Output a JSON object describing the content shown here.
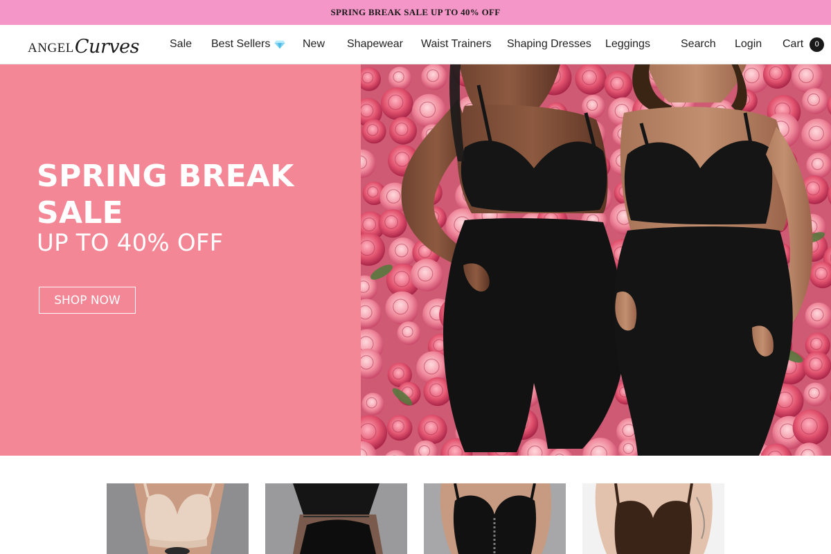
{
  "announcement": {
    "text": "SPRING BREAK SALE UP TO 40% OFF"
  },
  "header": {
    "logo": {
      "word1": "ANGEL",
      "word2": "Curves"
    },
    "nav": [
      {
        "label": "Sale"
      },
      {
        "label": "Best Sellers",
        "icon": "gem-icon"
      },
      {
        "label": "New"
      },
      {
        "label": "Shapewear"
      },
      {
        "label": "Waist Trainers"
      },
      {
        "label": "Shaping Dresses"
      },
      {
        "label": "Leggings"
      }
    ],
    "utility": {
      "search_label": "Search",
      "login_label": "Login",
      "cart_label": "Cart",
      "cart_count": "0"
    }
  },
  "hero": {
    "title_line1": "SPRING BREAK",
    "title_line2": "SALE",
    "subtitle": "UP TO 40% OFF",
    "cta_label": "SHOP NOW",
    "background_color": "#f38796",
    "image": "models-in-black-shapewear-before-rose-wall"
  },
  "products": [
    {
      "image": "nude-bra-shapewear"
    },
    {
      "image": "black-waist-trainer"
    },
    {
      "image": "black-corset-bodysuit"
    },
    {
      "image": "brown-shaping-bodysuit"
    }
  ],
  "colors": {
    "announcement_bg": "#f596c8",
    "hero_bg": "#f38796",
    "text_dark": "#1a1a1a"
  }
}
